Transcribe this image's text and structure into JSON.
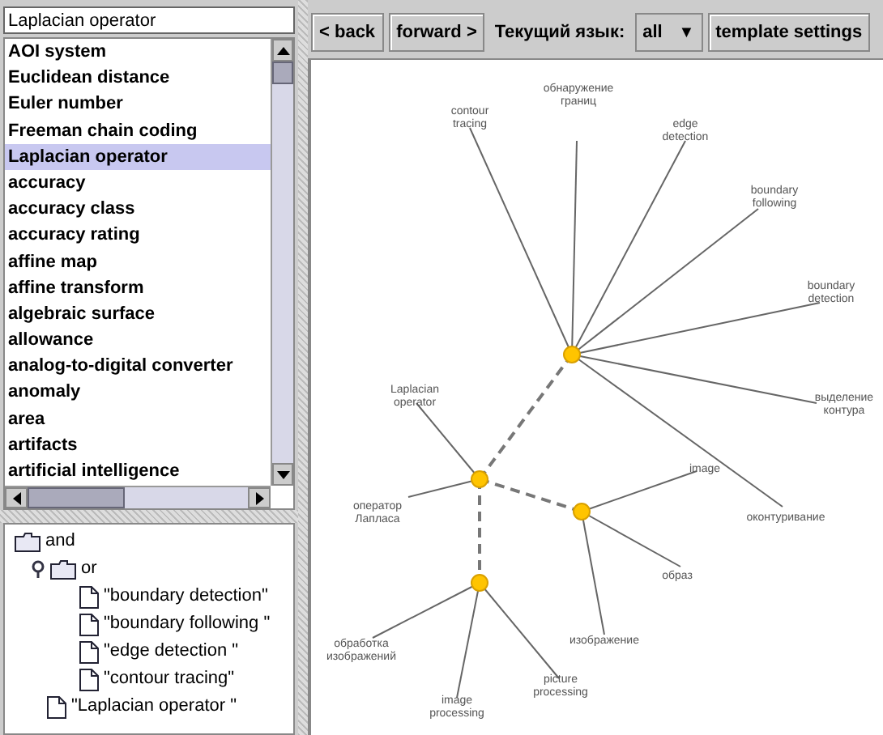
{
  "search": {
    "value": "Laplacian operator"
  },
  "term_list": [
    {
      "label": "AOI system",
      "selected": false
    },
    {
      "label": "Euclidean distance",
      "selected": false
    },
    {
      "label": "Euler number",
      "selected": false
    },
    {
      "label": "Freeman chain coding",
      "selected": false
    },
    {
      "label": "Laplacian operator",
      "selected": true
    },
    {
      "label": "accuracy",
      "selected": false
    },
    {
      "label": "accuracy class",
      "selected": false
    },
    {
      "label": "accuracy rating",
      "selected": false
    },
    {
      "label": "affine map",
      "selected": false
    },
    {
      "label": "affine transform",
      "selected": false
    },
    {
      "label": "algebraic surface",
      "selected": false
    },
    {
      "label": "allowance",
      "selected": false
    },
    {
      "label": "analog-to-digital converter",
      "selected": false
    },
    {
      "label": "anomaly",
      "selected": false
    },
    {
      "label": "area",
      "selected": false
    },
    {
      "label": "artifacts",
      "selected": false
    },
    {
      "label": "artificial intelligence",
      "selected": false
    }
  ],
  "query_tree": [
    {
      "label": "and",
      "kind": "folder",
      "children": [
        {
          "label": "or",
          "kind": "folder",
          "expanded": true,
          "children": [
            {
              "label": "\"boundary detection\"",
              "kind": "term"
            },
            {
              "label": "\"boundary following \"",
              "kind": "term"
            },
            {
              "label": "\"edge detection \"",
              "kind": "term"
            },
            {
              "label": "\"contour tracing\"",
              "kind": "term"
            }
          ]
        },
        {
          "label": "\"Laplacian operator \"",
          "kind": "term"
        }
      ]
    }
  ],
  "toolbar": {
    "back": "< back",
    "forward": "forward >",
    "language_label": "Текущий язык:",
    "language_value": "all",
    "dropdown_arrow": "▼",
    "template_settings": "template settings"
  },
  "graph": {
    "hubs": [
      {
        "leaves": [
          "Laplacian operator",
          "оператор Лапласа"
        ]
      },
      {
        "leaves": [
          "обработка изображений",
          "image processing",
          "picture processing"
        ]
      },
      {
        "leaves": [
          "contour tracing",
          "обнаружение границ",
          "edge detection",
          "boundary following",
          "boundary detection",
          "выделение контура",
          "оконтуривание"
        ]
      },
      {
        "leaves": [
          "image",
          "образ",
          "изображение"
        ]
      }
    ]
  }
}
